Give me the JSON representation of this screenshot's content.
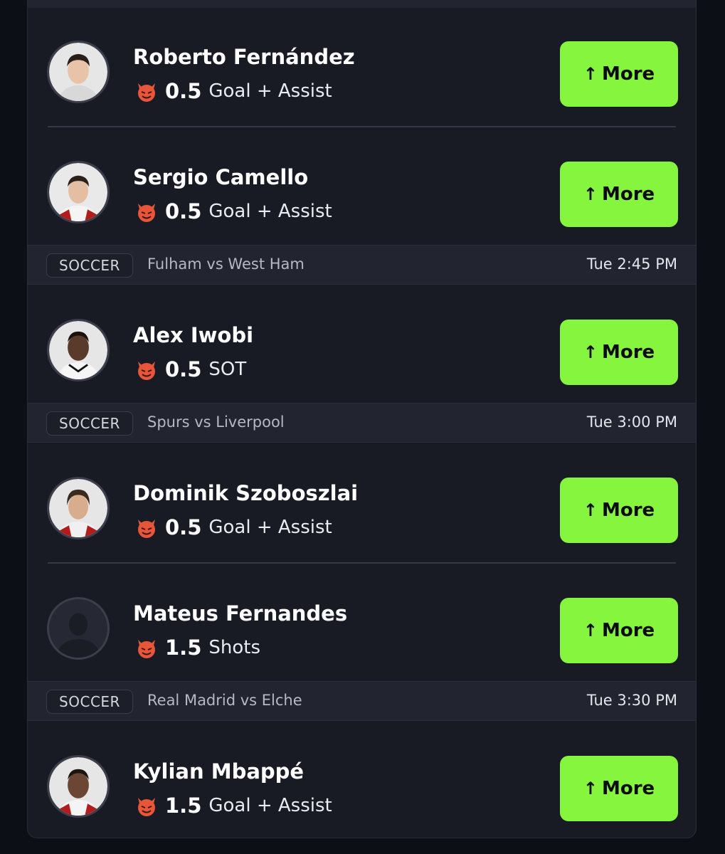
{
  "accent_color": "#86f53d",
  "button_icon": "arrow-up-icon",
  "stat_icon": "devil-icon",
  "sections": [
    {
      "sport": null,
      "match": null,
      "time": null,
      "players": [
        {
          "name": "Roberto Fernández",
          "line": "0.5",
          "stat": "Goal + Assist",
          "button": "More",
          "arrow": "↑"
        },
        {
          "name": "Sergio Camello",
          "line": "0.5",
          "stat": "Goal + Assist",
          "button": "More",
          "arrow": "↑"
        }
      ]
    },
    {
      "sport": "SOCCER",
      "match": "Fulham vs West Ham",
      "time": "Tue 2:45 PM",
      "players": [
        {
          "name": "Alex Iwobi",
          "line": "0.5",
          "stat": "SOT",
          "button": "More",
          "arrow": "↑"
        }
      ]
    },
    {
      "sport": "SOCCER",
      "match": "Spurs vs Liverpool",
      "time": "Tue 3:00 PM",
      "players": [
        {
          "name": "Dominik Szoboszlai",
          "line": "0.5",
          "stat": "Goal + Assist",
          "button": "More",
          "arrow": "↑"
        },
        {
          "name": "Mateus Fernandes",
          "line": "1.5",
          "stat": "Shots",
          "button": "More",
          "arrow": "↑"
        }
      ]
    },
    {
      "sport": "SOCCER",
      "match": "Real Madrid vs Elche",
      "time": "Tue 3:30 PM",
      "players": [
        {
          "name": "Kylian Mbappé",
          "line": "1.5",
          "stat": "Goal + Assist",
          "button": "More",
          "arrow": "↑"
        }
      ]
    }
  ]
}
